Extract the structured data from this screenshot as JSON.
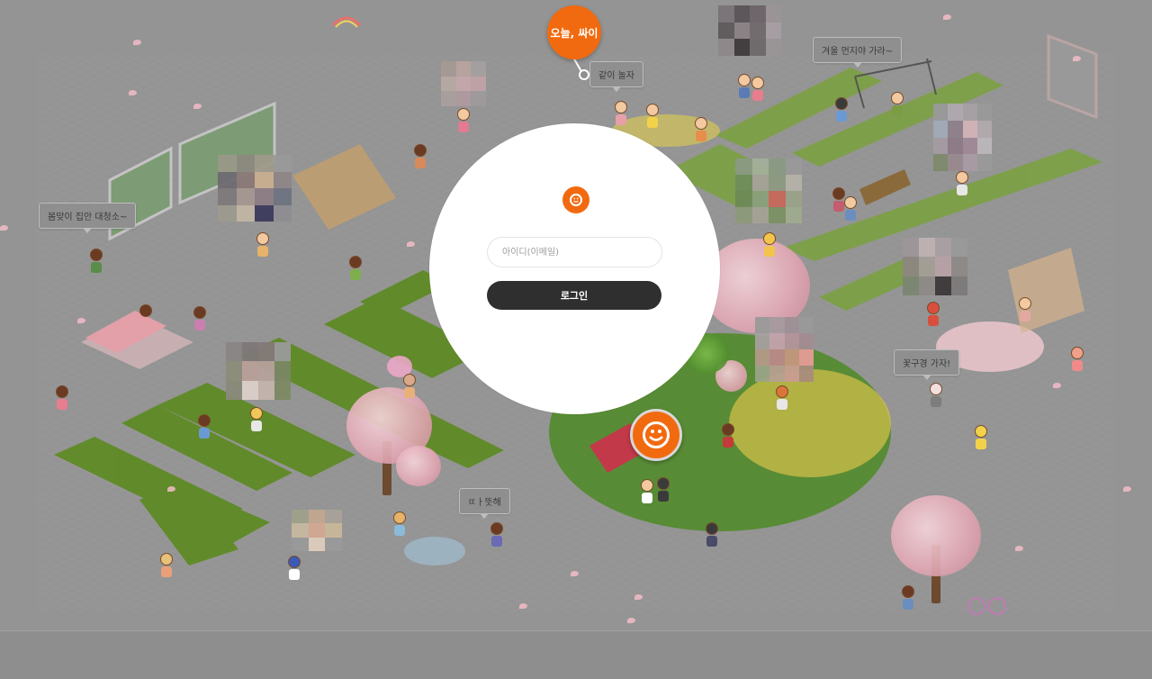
{
  "today_badge": {
    "label": "오늘, 싸이"
  },
  "speech_bubbles": [
    {
      "id": "play",
      "text": "같이 놀자"
    },
    {
      "id": "winter",
      "text": "겨울 먼지야 가라~"
    },
    {
      "id": "spring-clean",
      "text": "봄맞이 집안 대청소~"
    },
    {
      "id": "flowers",
      "text": "꽃구경 가자!"
    },
    {
      "id": "warm",
      "text": "ㄸㅏ뜻해"
    }
  ],
  "login": {
    "id_placeholder": "아이디(이메일)",
    "id_value": "",
    "submit_label": "로그인"
  },
  "colors": {
    "brand_orange": "#f26a0f",
    "button_dark": "#2f2f2f",
    "grass": "#5f8d22",
    "background": "#949494"
  },
  "icons": [
    "cyworld-smile-icon",
    "cyworld-emblem-icon"
  ]
}
